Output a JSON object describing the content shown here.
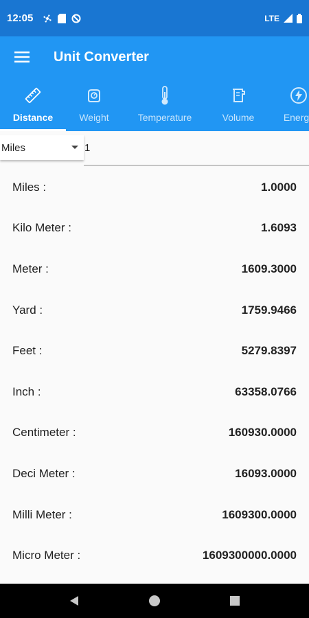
{
  "status": {
    "time": "12:05",
    "network": "LTE"
  },
  "app": {
    "title": "Unit Converter"
  },
  "tabs": [
    {
      "label": "Distance",
      "icon": "ruler-icon",
      "active": true
    },
    {
      "label": "Weight",
      "icon": "scale-icon",
      "active": false
    },
    {
      "label": "Temperature",
      "icon": "thermometer-icon",
      "active": false
    },
    {
      "label": "Volume",
      "icon": "beaker-icon",
      "active": false
    },
    {
      "label": "Energy",
      "icon": "lightning-icon",
      "active": false
    }
  ],
  "converter": {
    "selected_unit": "Miles",
    "input_value": "1"
  },
  "results": [
    {
      "label": "Miles :",
      "value": "1.0000"
    },
    {
      "label": "Kilo Meter :",
      "value": "1.6093"
    },
    {
      "label": "Meter :",
      "value": "1609.3000"
    },
    {
      "label": "Yard :",
      "value": "1759.9466"
    },
    {
      "label": "Feet :",
      "value": "5279.8397"
    },
    {
      "label": "Inch :",
      "value": "63358.0766"
    },
    {
      "label": "Centimeter :",
      "value": "160930.0000"
    },
    {
      "label": "Deci Meter :",
      "value": "16093.0000"
    },
    {
      "label": "Milli Meter :",
      "value": "1609300.0000"
    },
    {
      "label": "Micro Meter :",
      "value": "1609300000.0000"
    }
  ],
  "colors": {
    "status_bar": "#1976d2",
    "primary": "#2196f3"
  }
}
